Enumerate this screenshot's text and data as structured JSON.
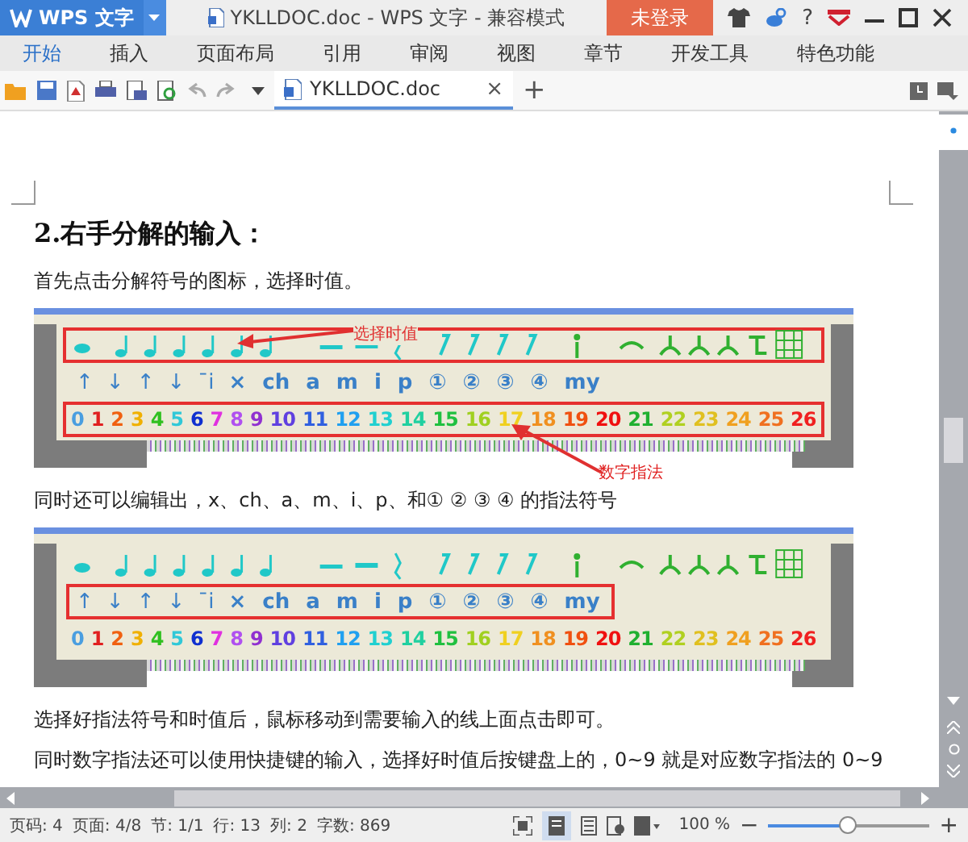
{
  "title_bar": {
    "app_name": "WPS 文字",
    "document_title": "YKLLDOC.doc - WPS 文字 - 兼容模式",
    "login_button": "未登录",
    "help": "?"
  },
  "menu": [
    {
      "label": "开始",
      "selected": true
    },
    {
      "label": "插入",
      "selected": false
    },
    {
      "label": "页面布局",
      "selected": false
    },
    {
      "label": "引用",
      "selected": false
    },
    {
      "label": "审阅",
      "selected": false
    },
    {
      "label": "视图",
      "selected": false
    },
    {
      "label": "章节",
      "selected": false
    },
    {
      "label": "开发工具",
      "selected": false
    },
    {
      "label": "特色功能",
      "selected": false
    }
  ],
  "doc_tabs": [
    {
      "label": "YKLLDOC.doc",
      "selected": true,
      "close": "×"
    }
  ],
  "new_tab": "+",
  "document": {
    "blocks": [
      {
        "kind": "heading",
        "text": "2.右手分解的输入："
      },
      {
        "kind": "paragraph",
        "text": "首先点击分解符号的图标，选择时值。"
      },
      {
        "kind": "image",
        "rows": [
          {
            "kind": "notes",
            "highlighted": true
          },
          {
            "kind": "symbols",
            "highlighted": false,
            "items": [
              "↑",
              "↓",
              "↑",
              "↓",
              "ˉi",
              "×",
              "ch",
              "a",
              "m",
              "i",
              "p",
              "①",
              "②",
              "③",
              "④",
              "my"
            ]
          },
          {
            "kind": "numbers",
            "highlighted": true,
            "items": [
              {
                "text": "0",
                "color": "#4a9ee0"
              },
              {
                "text": "1",
                "color": "#e02020"
              },
              {
                "text": "2",
                "color": "#f06010"
              },
              {
                "text": "3",
                "color": "#f0b000"
              },
              {
                "text": "4",
                "color": "#30c020"
              },
              {
                "text": "5",
                "color": "#30c8d8"
              },
              {
                "text": "6",
                "color": "#1030d0"
              },
              {
                "text": "7",
                "color": "#e030e0"
              },
              {
                "text": "8",
                "color": "#b050f0"
              },
              {
                "text": "9",
                "color": "#9030d0"
              },
              {
                "text": "10",
                "color": "#6040e0"
              },
              {
                "text": "11",
                "color": "#3060e0"
              },
              {
                "text": "12",
                "color": "#20a0f0"
              },
              {
                "text": "13",
                "color": "#20d0d0"
              },
              {
                "text": "14",
                "color": "#20d0a0"
              },
              {
                "text": "15",
                "color": "#20c040"
              },
              {
                "text": "16",
                "color": "#a0d020"
              },
              {
                "text": "17",
                "color": "#f0d020"
              },
              {
                "text": "18",
                "color": "#f09020"
              },
              {
                "text": "19",
                "color": "#f05010"
              },
              {
                "text": "20",
                "color": "#f01010"
              },
              {
                "text": "21",
                "color": "#20b030"
              },
              {
                "text": "22",
                "color": "#b0d020"
              },
              {
                "text": "23",
                "color": "#e0c020"
              },
              {
                "text": "24",
                "color": "#f0a020"
              },
              {
                "text": "25",
                "color": "#f07020"
              },
              {
                "text": "26",
                "color": "#f02020"
              }
            ]
          }
        ],
        "annotations": [
          {
            "text": "选择时值"
          },
          {
            "text": "数字指法"
          }
        ]
      },
      {
        "kind": "paragraph",
        "text": "同时还可以编辑出，x、ch、a、m、i、p、和① ② ③ ④ 的指法符号"
      },
      {
        "kind": "image",
        "rows": [
          {
            "kind": "notes",
            "highlighted": false
          },
          {
            "kind": "symbols",
            "highlighted": true,
            "items": [
              "↑",
              "↓",
              "↑",
              "↓",
              "ˉi",
              "×",
              "ch",
              "a",
              "m",
              "i",
              "p",
              "①",
              "②",
              "③",
              "④",
              "my"
            ]
          },
          {
            "kind": "numbers",
            "highlighted": false,
            "items": [
              {
                "text": "0",
                "color": "#4a9ee0"
              },
              {
                "text": "1",
                "color": "#e02020"
              },
              {
                "text": "2",
                "color": "#f06010"
              },
              {
                "text": "3",
                "color": "#f0b000"
              },
              {
                "text": "4",
                "color": "#30c020"
              },
              {
                "text": "5",
                "color": "#30c8d8"
              },
              {
                "text": "6",
                "color": "#1030d0"
              },
              {
                "text": "7",
                "color": "#e030e0"
              },
              {
                "text": "8",
                "color": "#b050f0"
              },
              {
                "text": "9",
                "color": "#9030d0"
              },
              {
                "text": "10",
                "color": "#6040e0"
              },
              {
                "text": "11",
                "color": "#3060e0"
              },
              {
                "text": "12",
                "color": "#20a0f0"
              },
              {
                "text": "13",
                "color": "#20d0d0"
              },
              {
                "text": "14",
                "color": "#20d0a0"
              },
              {
                "text": "15",
                "color": "#20c040"
              },
              {
                "text": "16",
                "color": "#a0d020"
              },
              {
                "text": "17",
                "color": "#f0d020"
              },
              {
                "text": "18",
                "color": "#f09020"
              },
              {
                "text": "19",
                "color": "#f05010"
              },
              {
                "text": "20",
                "color": "#f01010"
              },
              {
                "text": "21",
                "color": "#20b030"
              },
              {
                "text": "22",
                "color": "#b0d020"
              },
              {
                "text": "23",
                "color": "#e0c020"
              },
              {
                "text": "24",
                "color": "#f0a020"
              },
              {
                "text": "25",
                "color": "#f07020"
              },
              {
                "text": "26",
                "color": "#f02020"
              }
            ]
          }
        ]
      },
      {
        "kind": "paragraph",
        "text": "选择好指法符号和时值后，鼠标移动到需要输入的线上面点击即可。"
      },
      {
        "kind": "paragraph",
        "text": "同时数字指法还可以使用快捷键的输入，选择好时值后按键盘上的，0~9 就是对应数字指法的 0~9"
      }
    ]
  },
  "status_bar": {
    "items": [
      "页码: 4",
      "页面: 4/8",
      "节: 1/1",
      "行: 13",
      "列: 2",
      "字数: 869"
    ],
    "zoom": "100 %",
    "zoom_minus": "−",
    "zoom_plus": "+",
    "zoom_slider": {
      "level": 0.5
    }
  }
}
